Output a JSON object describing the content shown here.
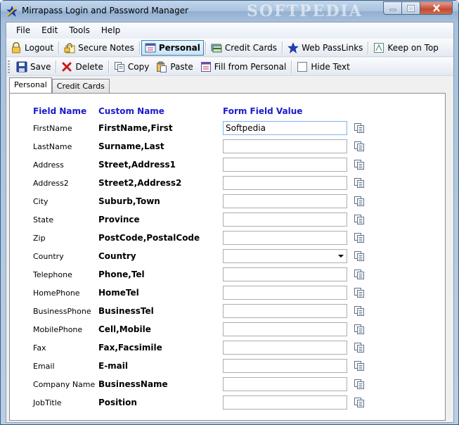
{
  "window": {
    "title": "Mirrapass Login and Password Manager",
    "watermark": "SOFTPEDIA"
  },
  "menubar": [
    "File",
    "Edit",
    "Tools",
    "Help"
  ],
  "toolbar1": {
    "logout": "Logout",
    "secure_notes": "Secure Notes",
    "personal": "Personal",
    "credit_cards": "Credit Cards",
    "web_passlinks": "Web PassLinks",
    "keep_on_top": "Keep on Top"
  },
  "toolbar2": {
    "save": "Save",
    "delete": "Delete",
    "copy": "Copy",
    "paste": "Paste",
    "fill_from_personal": "Fill from Personal",
    "hide_text": "Hide Text"
  },
  "tabs": [
    "Personal",
    "Credit Cards"
  ],
  "headers": {
    "field_name": "Field Name",
    "custom_name": "Custom Name",
    "form_field_value": "Form Field Value"
  },
  "rows": [
    {
      "field": "FirstName",
      "custom": "FirstName,First",
      "value": "Softpedia"
    },
    {
      "field": "LastName",
      "custom": "Surname,Last",
      "value": ""
    },
    {
      "field": "Address",
      "custom": "Street,Address1",
      "value": ""
    },
    {
      "field": "Address2",
      "custom": "Street2,Address2",
      "value": ""
    },
    {
      "field": "City",
      "custom": "Suburb,Town",
      "value": ""
    },
    {
      "field": "State",
      "custom": "Province",
      "value": ""
    },
    {
      "field": "Zip",
      "custom": "PostCode,PostalCode",
      "value": ""
    },
    {
      "field": "Country",
      "custom": "Country",
      "value": "",
      "type": "select"
    },
    {
      "field": "Telephone",
      "custom": "Phone,Tel",
      "value": ""
    },
    {
      "field": "HomePhone",
      "custom": "HomeTel",
      "value": ""
    },
    {
      "field": "BusinessPhone",
      "custom": "BusinessTel",
      "value": ""
    },
    {
      "field": "MobilePhone",
      "custom": "Cell,Mobile",
      "value": ""
    },
    {
      "field": "Fax",
      "custom": "Fax,Facsimile",
      "value": ""
    },
    {
      "field": "Email",
      "custom": "E-mail",
      "value": ""
    },
    {
      "field": "Company Name",
      "custom": "BusinessName",
      "value": ""
    },
    {
      "field": "JobTitle",
      "custom": "Position",
      "value": ""
    }
  ]
}
